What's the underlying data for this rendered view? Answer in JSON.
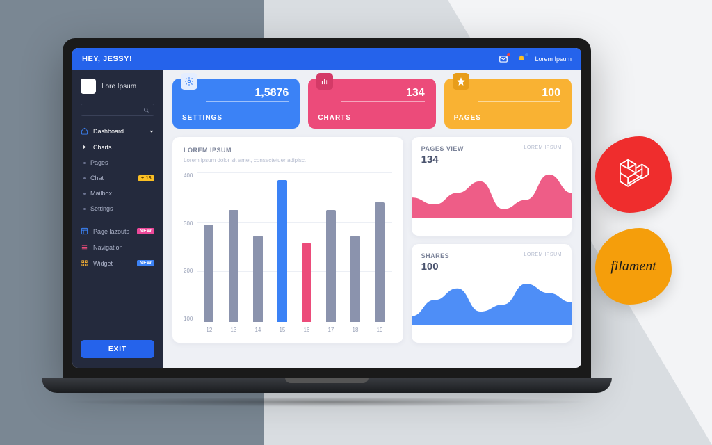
{
  "colors": {
    "blue": "#3b82f6",
    "pink": "#ec4b7a",
    "amber": "#f9b233",
    "grey": "#8b93ad"
  },
  "topbar": {
    "greeting": "HEY, JESSY!",
    "user_label": "Lorem Ipsum"
  },
  "sidebar": {
    "profile_name": "Lore Ipsum",
    "nav": {
      "dashboard": "Dashboard",
      "charts": "Charts",
      "pages": "Pages",
      "chat": "Chat",
      "chat_badge": "+ 13",
      "mailbox": "Mailbox",
      "settings": "Settings",
      "page_layouts": "Page lazouts",
      "page_layouts_badge": "NEW",
      "navigation": "Navigation",
      "widget": "Widget",
      "widget_badge": "NEW"
    },
    "exit_label": "EXIT"
  },
  "cards": [
    {
      "title": "SETTINGS",
      "value": "1,5876",
      "color": "blue",
      "icon": "gear"
    },
    {
      "title": "CHARTS",
      "value": "134",
      "color": "pink",
      "icon": "bars"
    },
    {
      "title": "PAGES",
      "value": "100",
      "color": "amber",
      "icon": "star"
    }
  ],
  "bar_panel": {
    "title": "LOREM IPSUM",
    "subtitle": "Lorem ipsum dolor sit amet, consectetuer adipisc."
  },
  "pages_view": {
    "title": "PAGES VIEW",
    "value": "134",
    "meta": "LOREM IPSUM"
  },
  "shares": {
    "title": "SHARES",
    "value": "100",
    "meta": "LOREM IPSUM"
  },
  "external": {
    "filament_label": "filament"
  },
  "chart_data": [
    {
      "type": "bar",
      "title": "LOREM IPSUM",
      "categories": [
        "12",
        "13",
        "14",
        "15",
        "16",
        "17",
        "18",
        "19"
      ],
      "ylim": [
        0,
        400
      ],
      "yticks": [
        400,
        300,
        200,
        100
      ],
      "series": [
        {
          "name": "main",
          "color": "#8b93ad",
          "values": [
            260,
            300,
            230,
            380,
            210,
            300,
            230,
            320
          ]
        },
        {
          "name": "highlight",
          "color_index_map": {
            "3": "#3b82f6",
            "4": "#ec4b7a"
          }
        }
      ]
    },
    {
      "type": "area",
      "title": "PAGES VIEW",
      "points": [
        0.45,
        0.3,
        0.55,
        0.8,
        0.2,
        0.4,
        0.95,
        0.55
      ],
      "color": "#ec4b7a"
    },
    {
      "type": "area",
      "title": "SHARES",
      "points": [
        0.2,
        0.55,
        0.8,
        0.3,
        0.45,
        0.9,
        0.7,
        0.5
      ],
      "color": "#3b82f6"
    }
  ]
}
